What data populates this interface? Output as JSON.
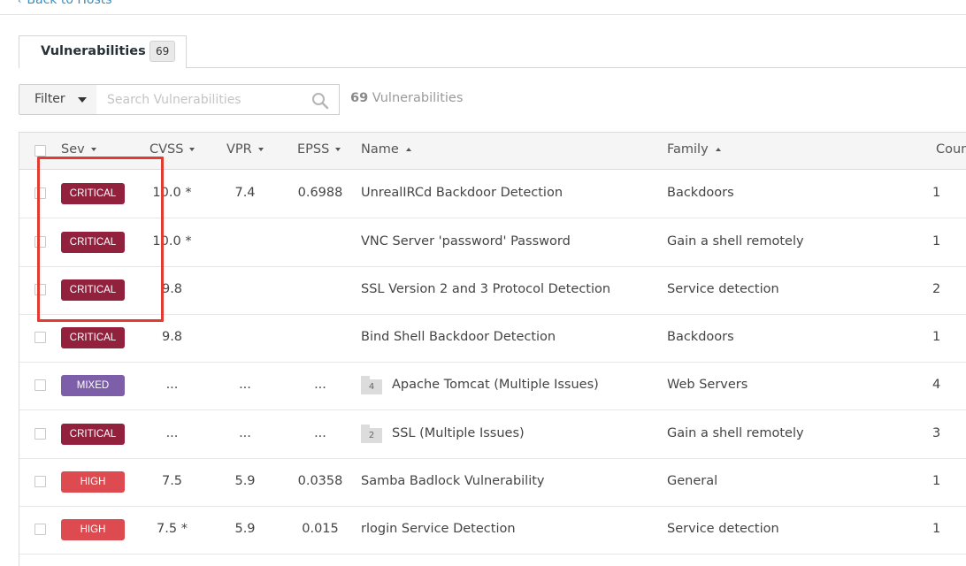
{
  "nav": {
    "back_label": "Back to Hosts"
  },
  "tabs": [
    {
      "label": "Vulnerabilities",
      "count": "69"
    }
  ],
  "toolbar": {
    "filter_label": "Filter",
    "search_placeholder": "Search Vulnerabilities",
    "total_count": "69",
    "total_suffix": "Vulnerabilities"
  },
  "table": {
    "columns": {
      "sev": "Sev",
      "cvss": "CVSS",
      "vpr": "VPR",
      "epss": "EPSS",
      "name": "Name",
      "family": "Family",
      "count": "Count"
    },
    "rows": [
      {
        "severity": "CRITICAL",
        "sev_color": "#92213d",
        "cvss": "10.0 *",
        "vpr": "7.4",
        "epss": "0.6988",
        "name": "UnrealIRCd Backdoor Detection",
        "family": "Backdoors",
        "count": "1"
      },
      {
        "severity": "CRITICAL",
        "sev_color": "#92213d",
        "cvss": "10.0 *",
        "vpr": "",
        "epss": "",
        "name": "VNC Server 'password' Password",
        "family": "Gain a shell remotely",
        "count": "1"
      },
      {
        "severity": "CRITICAL",
        "sev_color": "#92213d",
        "cvss": "9.8",
        "vpr": "",
        "epss": "",
        "name": "SSL Version 2 and 3 Protocol Detection",
        "family": "Service detection",
        "count": "2"
      },
      {
        "severity": "CRITICAL",
        "sev_color": "#92213d",
        "cvss": "9.8",
        "vpr": "",
        "epss": "",
        "name": "Bind Shell Backdoor Detection",
        "family": "Backdoors",
        "count": "1"
      },
      {
        "severity": "MIXED",
        "sev_color": "#7d5ea8",
        "cvss": "...",
        "vpr": "...",
        "epss": "...",
        "group_count": "4",
        "name": "Apache Tomcat (Multiple Issues)",
        "family": "Web Servers",
        "count": "4"
      },
      {
        "severity": "CRITICAL",
        "sev_color": "#92213d",
        "cvss": "...",
        "vpr": "...",
        "epss": "...",
        "group_count": "2",
        "name": "SSL (Multiple Issues)",
        "family": "Gain a shell remotely",
        "count": "3"
      },
      {
        "severity": "HIGH",
        "sev_color": "#dd4b50",
        "cvss": "7.5",
        "vpr": "5.9",
        "epss": "0.0358",
        "name": "Samba Badlock Vulnerability",
        "family": "General",
        "count": "1"
      },
      {
        "severity": "HIGH",
        "sev_color": "#dd4b50",
        "cvss": "7.5 *",
        "vpr": "5.9",
        "epss": "0.015",
        "name": "rlogin Service Detection",
        "family": "Service detection",
        "count": "1"
      }
    ]
  },
  "colors": {
    "accent": "#3c8dbc",
    "highlight_box": "#e03c31"
  }
}
